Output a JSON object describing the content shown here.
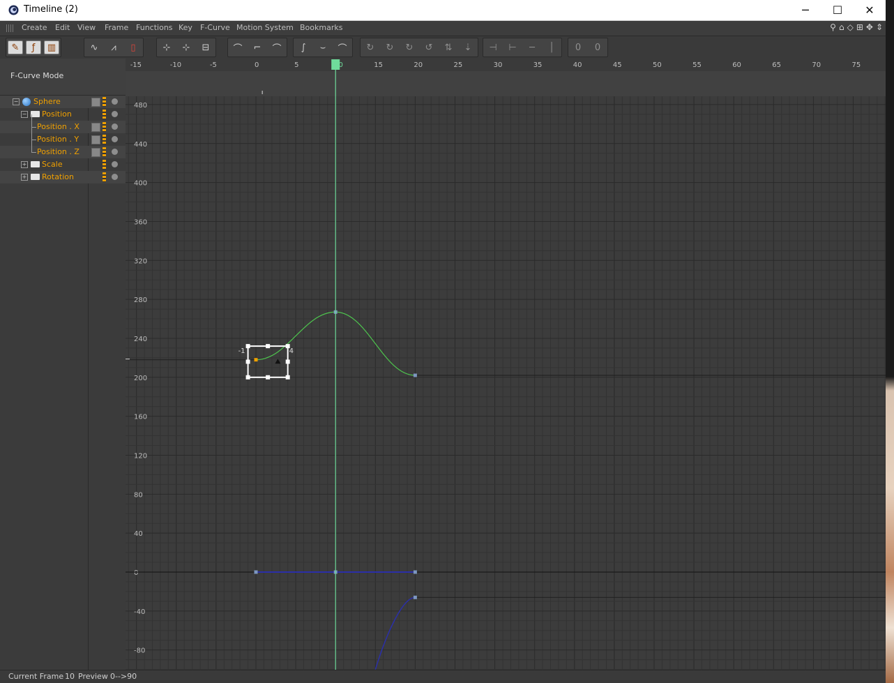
{
  "window": {
    "title": "Timeline (2)",
    "app_icon": "cinema4d-icon",
    "controls": {
      "minimize": "─",
      "maximize": "☐",
      "close": "✕"
    }
  },
  "menu": {
    "items": [
      "Create",
      "Edit",
      "View",
      "Frame",
      "Functions",
      "Key",
      "F-Curve",
      "Motion System",
      "Bookmarks"
    ],
    "nav_icons": [
      {
        "name": "search-icon",
        "glyph": "⚲"
      },
      {
        "name": "home-icon",
        "glyph": "⌂"
      },
      {
        "name": "frame-all-icon",
        "glyph": "◇"
      },
      {
        "name": "frame-selected-icon",
        "glyph": "⊞"
      },
      {
        "name": "move-view-icon",
        "glyph": "✥"
      },
      {
        "name": "zoom-view-icon",
        "glyph": "⇕"
      }
    ]
  },
  "toolbar": {
    "groups": [
      {
        "x": 8,
        "buttons": [
          {
            "name": "keymode-icon",
            "glyph": "✎",
            "style": "light"
          },
          {
            "name": "fcurve-mode-icon",
            "glyph": "ƒ",
            "style": "light"
          },
          {
            "name": "motion-mode-icon",
            "glyph": "▥",
            "style": "light"
          }
        ]
      },
      {
        "x": 120,
        "buttons": [
          {
            "name": "normalize-curve-icon",
            "glyph": "∿"
          },
          {
            "name": "snap-curve-icon",
            "glyph": "⩘"
          },
          {
            "name": "clip-icon",
            "glyph": "▯",
            "style": "red"
          }
        ]
      },
      {
        "x": 224,
        "buttons": [
          {
            "name": "add-key-icon",
            "glyph": "⊹"
          },
          {
            "name": "add-multiple-keys-icon",
            "glyph": "⊹"
          },
          {
            "name": "delete-key-icon",
            "glyph": "⊟"
          }
        ]
      },
      {
        "x": 326,
        "buttons": [
          {
            "name": "linear-interpolation-icon",
            "glyph": "⌒"
          },
          {
            "name": "step-interpolation-icon",
            "glyph": "⌐"
          },
          {
            "name": "spline-interpolation-icon",
            "glyph": "⌒"
          }
        ]
      },
      {
        "x": 420,
        "buttons": [
          {
            "name": "ease-ease-icon",
            "glyph": "∫"
          },
          {
            "name": "ease-in-icon",
            "glyph": "⌣"
          },
          {
            "name": "ease-out-icon",
            "glyph": "⌒"
          }
        ]
      },
      {
        "x": 516,
        "buttons": [
          {
            "name": "zero-angle-icon",
            "glyph": "↻",
            "style": "dim"
          },
          {
            "name": "zero-length-icon",
            "glyph": "↻",
            "style": "dim"
          },
          {
            "name": "lock-tangent-icon",
            "glyph": "↻",
            "style": "dim"
          },
          {
            "name": "break-tangent-icon",
            "glyph": "↺",
            "style": "dim"
          },
          {
            "name": "tangent-weight-icon",
            "glyph": "⇅",
            "style": "dim"
          },
          {
            "name": "tangent-unify-icon",
            "glyph": "⇣",
            "style": "dim"
          }
        ]
      },
      {
        "x": 692,
        "buttons": [
          {
            "name": "flatten-tangent-icon",
            "glyph": "⊣",
            "style": "dim"
          },
          {
            "name": "align-tangent-icon",
            "glyph": "⊢",
            "style": "dim"
          },
          {
            "name": "horizontal-tangent-icon",
            "glyph": "─",
            "style": "dim"
          },
          {
            "name": "vertical-tangent-icon",
            "glyph": "│",
            "style": "dim"
          }
        ]
      },
      {
        "x": 814,
        "buttons": [
          {
            "name": "zero-key-value-icon",
            "glyph": "0",
            "style": "dim"
          },
          {
            "name": "zero-tangent-icon",
            "glyph": "0",
            "style": "dim"
          }
        ]
      }
    ]
  },
  "left_panel": {
    "mode_label": "F-Curve Mode",
    "tree": [
      {
        "label": "Sphere",
        "indent": 0,
        "icon": "globe",
        "expander": "−",
        "has_curve_icon": true
      },
      {
        "label": "Position",
        "indent": 1,
        "icon": "folder-open",
        "expander": "−",
        "has_curve_icon": false
      },
      {
        "label": "Position . X",
        "indent": 2,
        "icon": "none",
        "expander": "",
        "has_curve_icon": true
      },
      {
        "label": "Position . Y",
        "indent": 2,
        "icon": "none",
        "expander": "",
        "has_curve_icon": true
      },
      {
        "label": "Position . Z",
        "indent": 2,
        "icon": "none",
        "expander": "",
        "has_curve_icon": true
      },
      {
        "label": "Scale",
        "indent": 1,
        "icon": "folder",
        "expander": "+",
        "has_curve_icon": false
      },
      {
        "label": "Rotation",
        "indent": 1,
        "icon": "folder",
        "expander": "+",
        "has_curve_icon": false
      }
    ]
  },
  "graph": {
    "current_frame": 10,
    "x_ticks": [
      "-15",
      "-10",
      "-5",
      "0",
      "5",
      "10",
      "15",
      "20",
      "25",
      "30",
      "35",
      "40",
      "45",
      "50",
      "55",
      "60",
      "65",
      "70",
      "75"
    ],
    "y_ticks": [
      "480",
      "440",
      "400",
      "360",
      "320",
      "280",
      "240",
      "200",
      "160",
      "120",
      "80",
      "40",
      "0",
      "-40",
      "-80"
    ],
    "selection_labels": {
      "left": "-1",
      "right": "4"
    },
    "colors": {
      "background": "#3c3c3c",
      "grid_minor": "#333333",
      "grid_major": "#2a2a2a",
      "playhead": "#6fdc9b",
      "curve_y": "#4ec44e",
      "curve_blue": "#2b2fa8",
      "key": "#7d97c0",
      "key_selected": "#f0a000"
    },
    "curves": {
      "position_y": {
        "points": [
          [
            0,
            218
          ],
          [
            10,
            267
          ],
          [
            20,
            202
          ]
        ]
      },
      "position_x": {
        "points": [
          [
            0,
            0
          ],
          [
            10,
            0
          ],
          [
            20,
            0
          ]
        ]
      },
      "position_z": {
        "points": [
          [
            15,
            -100
          ],
          [
            20,
            -26
          ]
        ]
      }
    }
  },
  "status": {
    "current_frame_label": "Current Frame",
    "current_frame_value": "10",
    "preview_label": "Preview",
    "preview_value": "0-->90"
  }
}
